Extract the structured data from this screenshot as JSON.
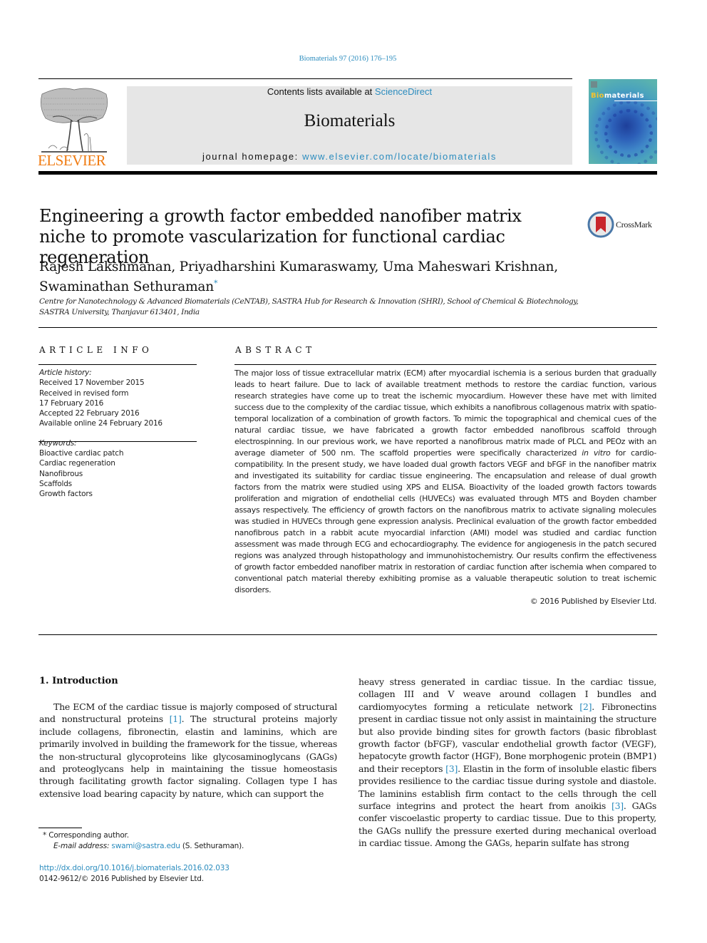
{
  "header": {
    "citation": "Biomaterials 97 (2016) 176–195",
    "publisher_logo_text": "ELSEVIER",
    "contents_prefix": "Contents lists available at ",
    "contents_link": "ScienceDirect",
    "journal_name": "Biomaterials",
    "homepage_prefix": "journal homepage: ",
    "homepage_link": "www.elsevier.com/locate/biomaterials",
    "cover_title_highlight": "Bio",
    "cover_title_rest": "materials"
  },
  "article": {
    "title": "Engineering a growth factor embedded nanofiber matrix niche to promote vascularization for functional cardiac regeneration",
    "crossmark_label": "CrossMark",
    "authors": "Rajesh Lakshmanan, Priyadharshini Kumaraswamy, Uma Maheswari Krishnan, Swaminathan Sethuraman",
    "corresponding_mark": "*",
    "affiliation": "Centre for Nanotechnology & Advanced Biomaterials (CeNTAB), SASTRA Hub for Research & Innovation (SHRI), School of Chemical & Biotechnology, SASTRA University, Thanjavur 613401, India"
  },
  "article_info": {
    "heading": "ARTICLE INFO",
    "history_label": "Article history:",
    "history": [
      "Received 17 November 2015",
      "Received in revised form",
      "17 February 2016",
      "Accepted 22 February 2016",
      "Available online 24 February 2016"
    ],
    "keywords_label": "Keywords:",
    "keywords": [
      "Bioactive cardiac patch",
      "Cardiac regeneration",
      "Nanofibrous",
      "Scaffolds",
      "Growth factors"
    ]
  },
  "abstract": {
    "heading": "ABSTRACT",
    "text_1": "The major loss of tissue extracellular matrix (ECM) after myocardial ischemia is a serious burden that gradually leads to heart failure. Due to lack of available treatment methods to restore the cardiac function, various research strategies have come up to treat the ischemic myocardium. However these have met with limited success due to the complexity of the cardiac tissue, which exhibits a nanofibrous collagenous matrix with spatio-temporal localization of a combination of growth factors. To mimic the topographical and chemical cues of the natural cardiac tissue, we have fabricated a growth factor embedded nanofibrous scaffold through electrospinning. In our previous work, we have reported a nanofibrous matrix made of PLCL and PEOz with an average diameter of 500 nm. The scaffold properties were specifically characterized ",
    "text_italic": "in vitro",
    "text_2": " for cardio-compatibility. In the present study, we have loaded dual growth factors VEGF and bFGF in the nanofiber matrix and investigated its suitability for cardiac tissue engineering. The encapsulation and release of dual growth factors from the matrix were studied using XPS and ELISA. Bioactivity of the loaded growth factors towards proliferation and migration of endothelial cells (HUVECs) was evaluated through MTS and Boyden chamber assays respectively. The efficiency of growth factors on the nanofibrous matrix to activate signaling molecules was studied in HUVECs through gene expression analysis. Preclinical evaluation of the growth factor embedded nanofibrous patch in a rabbit acute myocardial infarction (AMI) model was studied and cardiac function assessment was made through ECG and echocardiography. The evidence for angiogenesis in the patch secured regions was analyzed through histopathology and immunohistochemistry. Our results confirm the effectiveness of growth factor embedded nanofiber matrix in restoration of cardiac function after ischemia when compared to conventional patch material thereby exhibiting promise as a valuable therapeutic solution to treat ischemic disorders.",
    "copyright": "© 2016 Published by Elsevier Ltd."
  },
  "introduction": {
    "heading": "1.  Introduction",
    "left": [
      "The ECM of the cardiac tissue is majorly composed of structural and nonstructural proteins ",
      "[1]",
      ". The structural proteins majorly include collagens, fibronectin, elastin and laminins, which are primarily involved in building the framework for the tissue, whereas the non-structural glycoproteins like glycosaminoglycans (GAGs) and proteoglycans help in maintaining the tissue homeostasis through facilitating growth factor signaling. Collagen type I has extensive load bearing capacity by nature, which can support the"
    ],
    "right": [
      "heavy stress generated in cardiac tissue. In the cardiac tissue, collagen III and V weave around collagen I bundles and cardiomyocytes forming a reticulate network ",
      "[2]",
      ". Fibronectins present in cardiac tissue not only assist in maintaining the structure but also provide binding sites for growth factors (basic fibroblast growth factor (bFGF), vascular endothelial growth factor (VEGF), hepatocyte growth factor (HGF), Bone morphogenic protein (BMP1) and their receptors ",
      "[3]",
      ". Elastin in the form of insoluble elastic fibers provides resilience to the cardiac tissue during systole and diastole. The laminins establish firm contact to the cells through the cell surface integrins and protect the heart from anoikis ",
      "[3]",
      ". GAGs confer viscoelastic property to cardiac tissue. Due to this property, the GAGs nullify the pressure exerted during mechanical overload in cardiac tissue. Among the GAGs, heparin sulfate has strong"
    ]
  },
  "footnotes": {
    "corresponding": "* Corresponding author.",
    "email_label": "E-mail address: ",
    "email": "swami@sastra.edu",
    "email_suffix": " (S. Sethuraman).",
    "doi": "http://dx.doi.org/10.1016/j.biomaterials.2016.02.033",
    "issn": "0142-9612/© 2016 Published by Elsevier Ltd."
  }
}
